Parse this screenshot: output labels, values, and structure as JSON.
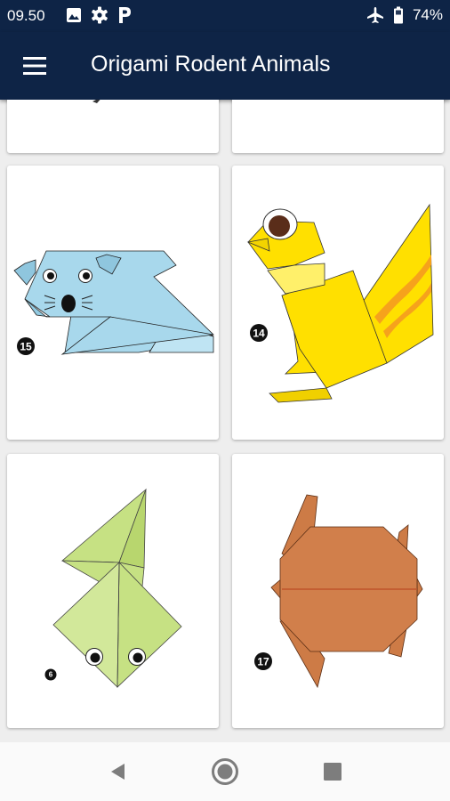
{
  "status_bar": {
    "time": "09.50",
    "battery": "74%",
    "left_icons": [
      "image-icon",
      "gear-icon",
      "parking-icon"
    ],
    "right_icons": [
      "airplane-icon",
      "battery-icon"
    ]
  },
  "app_bar": {
    "title": "Origami Rodent Animals",
    "menu_icon": "hamburger-menu-icon"
  },
  "cards": [
    {
      "id": "card-top-left",
      "label": ""
    },
    {
      "id": "card-top-right",
      "label": ""
    },
    {
      "id": "card-mouse",
      "label": "15",
      "subject": "mouse"
    },
    {
      "id": "card-squirrel",
      "label": "14",
      "subject": "squirrel"
    },
    {
      "id": "card-frog",
      "label": "6",
      "subject": "frog"
    },
    {
      "id": "card-turtle",
      "label": "17",
      "subject": "turtle"
    }
  ],
  "nav_bar": {
    "buttons": [
      "back-triangle-icon",
      "home-circle-icon",
      "recents-square-icon"
    ]
  },
  "colors": {
    "bar": "#0e2446",
    "mouse": "#a8d8ec",
    "squirrel": "#ffe000",
    "squirrel_tail_stripe": "#f6a21c",
    "frog": "#c6e183",
    "turtle": "#d17f4b"
  }
}
